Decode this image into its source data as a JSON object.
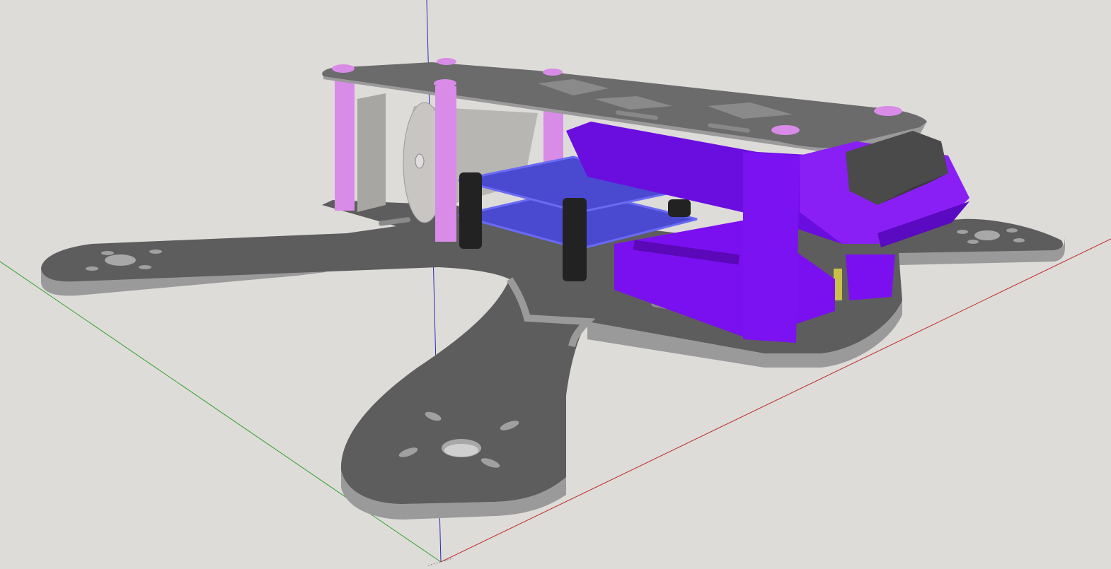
{
  "viewport": {
    "background": "#dedcd8",
    "axes": {
      "x_color": "#c0262a",
      "y_color": "#2fa12f",
      "z_color": "#2b2bb8"
    }
  },
  "model": {
    "frame_color": "#5d5d5d",
    "frame_edge_color": "#9a9a9a",
    "plate_color": "#6b6b6b",
    "standoff_color": "#d98be8",
    "mount_color": "#7a10f0",
    "pcb_color": "#4a4ad0",
    "pcb_edge_color": "#6a6af5",
    "black_standoff_color": "#222222",
    "motor_color": "#b8b6b2",
    "camera_color": "#4a4a4a",
    "battery_color": "#c8c04a"
  }
}
